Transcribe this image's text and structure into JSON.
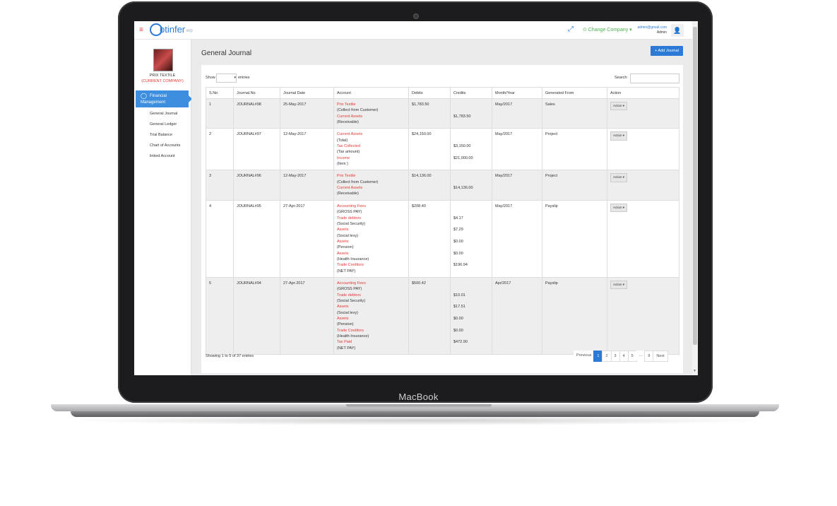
{
  "device": {
    "brand": "MacBook"
  },
  "topbar": {
    "menu_icon": "hamburger-icon",
    "logo_text": "ptinfer",
    "logo_sub": "erp",
    "change_company": "⊙ Change Company ▾",
    "user_email": "admin@gmail.com",
    "user_role": "Admin"
  },
  "sidebar": {
    "company_name": "PRIX TEXTILE",
    "company_tag": "(CURRENT COMPANY)",
    "active_menu_line1": "Financial",
    "active_menu_line2": "Management",
    "items": [
      "General Journal",
      "General Ledger",
      "Trial Balance",
      "Chart of Accounts",
      "linked Account"
    ]
  },
  "main": {
    "title": "General Journal",
    "add_button": "+ Add Journal",
    "show_label": "Show",
    "show_value": "▾",
    "entries_label": "entries",
    "search_label": "Search:",
    "columns": [
      "S.No",
      "Journal.No",
      "Journal Date",
      "Account",
      "Debits",
      "Credits",
      "Month/Year",
      "Generated From",
      "Action"
    ],
    "action_label": "Action ▾",
    "rows": [
      {
        "sno": "1",
        "journal": "JOURNAL#98",
        "date": "25-May-2017",
        "accounts": [
          "Prix Textile",
          "(Collect from Customer)",
          "Current Assets",
          "(Receivable)"
        ],
        "debits": [
          "$1,783.50",
          "",
          "",
          ""
        ],
        "credits": [
          "",
          "",
          "$1,783.50",
          ""
        ],
        "month": "May/2017",
        "from": "Sales"
      },
      {
        "sno": "2",
        "journal": "JOURNAL#97",
        "date": "12-May-2017",
        "accounts": [
          "Current Assets",
          "(Total)",
          "Tax Collected",
          "(Tax amount)",
          "Income",
          "(Item )"
        ],
        "debits": [
          "$24,150.00",
          "",
          "",
          "",
          "",
          ""
        ],
        "credits": [
          "",
          "",
          "$3,150.00",
          "",
          "$21,000.00",
          ""
        ],
        "month": "May/2017",
        "from": "Project"
      },
      {
        "sno": "3",
        "journal": "JOURNAL#96",
        "date": "12-May-2017",
        "accounts": [
          "Prix Textile",
          "(Collect from Customer)",
          "Current Assets",
          "(Receivable)"
        ],
        "debits": [
          "$14,136.00",
          "",
          "",
          ""
        ],
        "credits": [
          "",
          "",
          "$14,136.00",
          ""
        ],
        "month": "May/2017",
        "from": "Project"
      },
      {
        "sno": "4",
        "journal": "JOURNAL#95",
        "date": "27-Apr-2017",
        "accounts": [
          "Accounting Fees",
          "(GROSS PAY)",
          "Trade debtors",
          "(Social Security)",
          "Assets",
          "(Social levy)",
          "Assets",
          "(Pension)",
          "Assets",
          "(Health Insurance)",
          "Trade Creditors",
          "(NET PAY)"
        ],
        "debits": [
          "$208.40",
          "",
          "",
          "",
          "",
          "",
          "",
          "",
          "",
          "",
          "",
          ""
        ],
        "credits": [
          "",
          "",
          "$4.17",
          "",
          "$7.29",
          "",
          "$0.00",
          "",
          "$0.00",
          "",
          "$196.94",
          ""
        ],
        "month": "May/2017",
        "from": "Payslip"
      },
      {
        "sno": "5",
        "journal": "JOURNAL#94",
        "date": "27-Apr-2017",
        "accounts": [
          "Accounting Fees",
          "(GROSS PAY)",
          "Trade debtors",
          "(Social Security)",
          "Assets",
          "(Social levy)",
          "Assets",
          "(Pension)",
          "Trade Creditors",
          "(Health Insurance)",
          "Tax Paid",
          "(NET PAY)"
        ],
        "debits": [
          "$500.42",
          "",
          "",
          "",
          "",
          "",
          "",
          "",
          "",
          "",
          "",
          ""
        ],
        "credits": [
          "",
          "",
          "$10.01",
          "",
          "$17.51",
          "",
          "$0.00",
          "",
          "$0.00",
          "",
          "$472.90",
          ""
        ],
        "month": "Apr/2017",
        "from": "Payslip"
      }
    ],
    "footer_info": "Showing 1 to 5 of 37 entries",
    "pagination": [
      "Previous",
      "1",
      "2",
      "3",
      "4",
      "5",
      "...",
      "8",
      "Next"
    ]
  },
  "colors": {
    "accent": "#2b7bd6",
    "account_red": "#e53935",
    "company_green": "#4caf50"
  }
}
